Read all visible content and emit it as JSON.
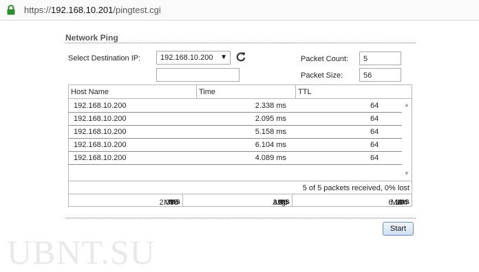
{
  "browser": {
    "url_scheme": "https://",
    "url_host": "192.168.10.201",
    "url_path": "/pingtest.cgi"
  },
  "section": {
    "title": "Network Ping"
  },
  "form": {
    "dest_label": "Select Destination IP:",
    "dest_value": "192.168.10.200",
    "custom_ip_value": "",
    "packet_count_label": "Packet Count:",
    "packet_count_value": "5",
    "packet_size_label": "Packet Size:",
    "packet_size_value": "56"
  },
  "table": {
    "headers": {
      "host": "Host Name",
      "time": "Time",
      "ttl": "TTL"
    },
    "rows": [
      {
        "host": "192.168.10.200",
        "time": "2.338 ms",
        "ttl": "64"
      },
      {
        "host": "192.168.10.200",
        "time": "2.095 ms",
        "ttl": "64"
      },
      {
        "host": "192.168.10.200",
        "time": "5.158 ms",
        "ttl": "64"
      },
      {
        "host": "192.168.10.200",
        "time": "6.104 ms",
        "ttl": "64"
      },
      {
        "host": "192.168.10.200",
        "time": "4.089 ms",
        "ttl": "64"
      }
    ],
    "status": "5 of 5 packets received, 0% lost",
    "min_label": "Min:",
    "min_value": "2.095",
    "min_unit": "ms",
    "avg_label": "Avg:",
    "avg_value": "3.96",
    "avg_unit": "ms",
    "max_label": "Max:",
    "max_value": "6.104",
    "max_unit": "ms"
  },
  "actions": {
    "start_label": "Start"
  },
  "watermark": "UBNT.SU"
}
